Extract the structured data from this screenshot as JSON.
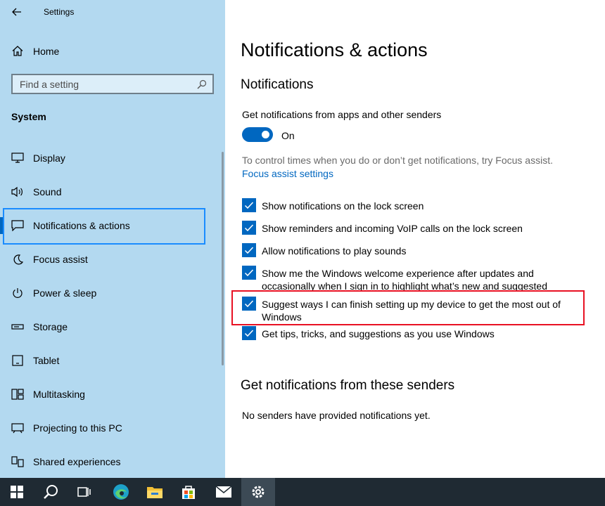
{
  "window": {
    "title": "Settings"
  },
  "sidebar": {
    "home_label": "Home",
    "search_placeholder": "Find a setting",
    "section_title": "System",
    "items": [
      {
        "label": "Display",
        "icon": "monitor-icon"
      },
      {
        "label": "Sound",
        "icon": "speaker-icon"
      },
      {
        "label": "Notifications & actions",
        "icon": "notification-icon",
        "selected": true
      },
      {
        "label": "Focus assist",
        "icon": "moon-icon"
      },
      {
        "label": "Power & sleep",
        "icon": "power-icon"
      },
      {
        "label": "Storage",
        "icon": "storage-icon"
      },
      {
        "label": "Tablet",
        "icon": "tablet-icon"
      },
      {
        "label": "Multitasking",
        "icon": "multitasking-icon"
      },
      {
        "label": "Projecting to this PC",
        "icon": "projector-icon"
      },
      {
        "label": "Shared experiences",
        "icon": "shared-icon"
      }
    ]
  },
  "main": {
    "page_title": "Notifications & actions",
    "notifications_title": "Notifications",
    "get_notifications_label": "Get notifications from apps and other senders",
    "toggle_state": "On",
    "focus_hint": "To control times when you do or don’t get notifications, try Focus assist.",
    "focus_link": "Focus assist settings",
    "checkboxes": [
      {
        "label": "Show notifications on the lock screen",
        "checked": true
      },
      {
        "label": "Show reminders and incoming VoIP calls on the lock screen",
        "checked": true
      },
      {
        "label": "Allow notifications to play sounds",
        "checked": true
      },
      {
        "label": "Show me the Windows welcome experience after updates and occasionally when I sign in to highlight what’s new and suggested",
        "checked": true
      },
      {
        "label": "Suggest ways I can finish setting up my device to get the most out of Windows",
        "checked": true
      },
      {
        "label": "Get tips, tricks, and suggestions as you use Windows",
        "checked": true
      }
    ],
    "senders_title": "Get notifications from these senders",
    "no_senders": "No senders have provided notifications yet."
  },
  "taskbar": {
    "items": [
      "windows-start-icon",
      "search-icon",
      "task-view-icon",
      "edge-icon",
      "file-explorer-icon",
      "store-icon",
      "mail-icon",
      "settings-icon"
    ],
    "active": "settings-icon"
  },
  "colors": {
    "accent": "#0067c0",
    "sidebar_bg": "#b3d9f0",
    "highlight_box": "#e81123"
  }
}
